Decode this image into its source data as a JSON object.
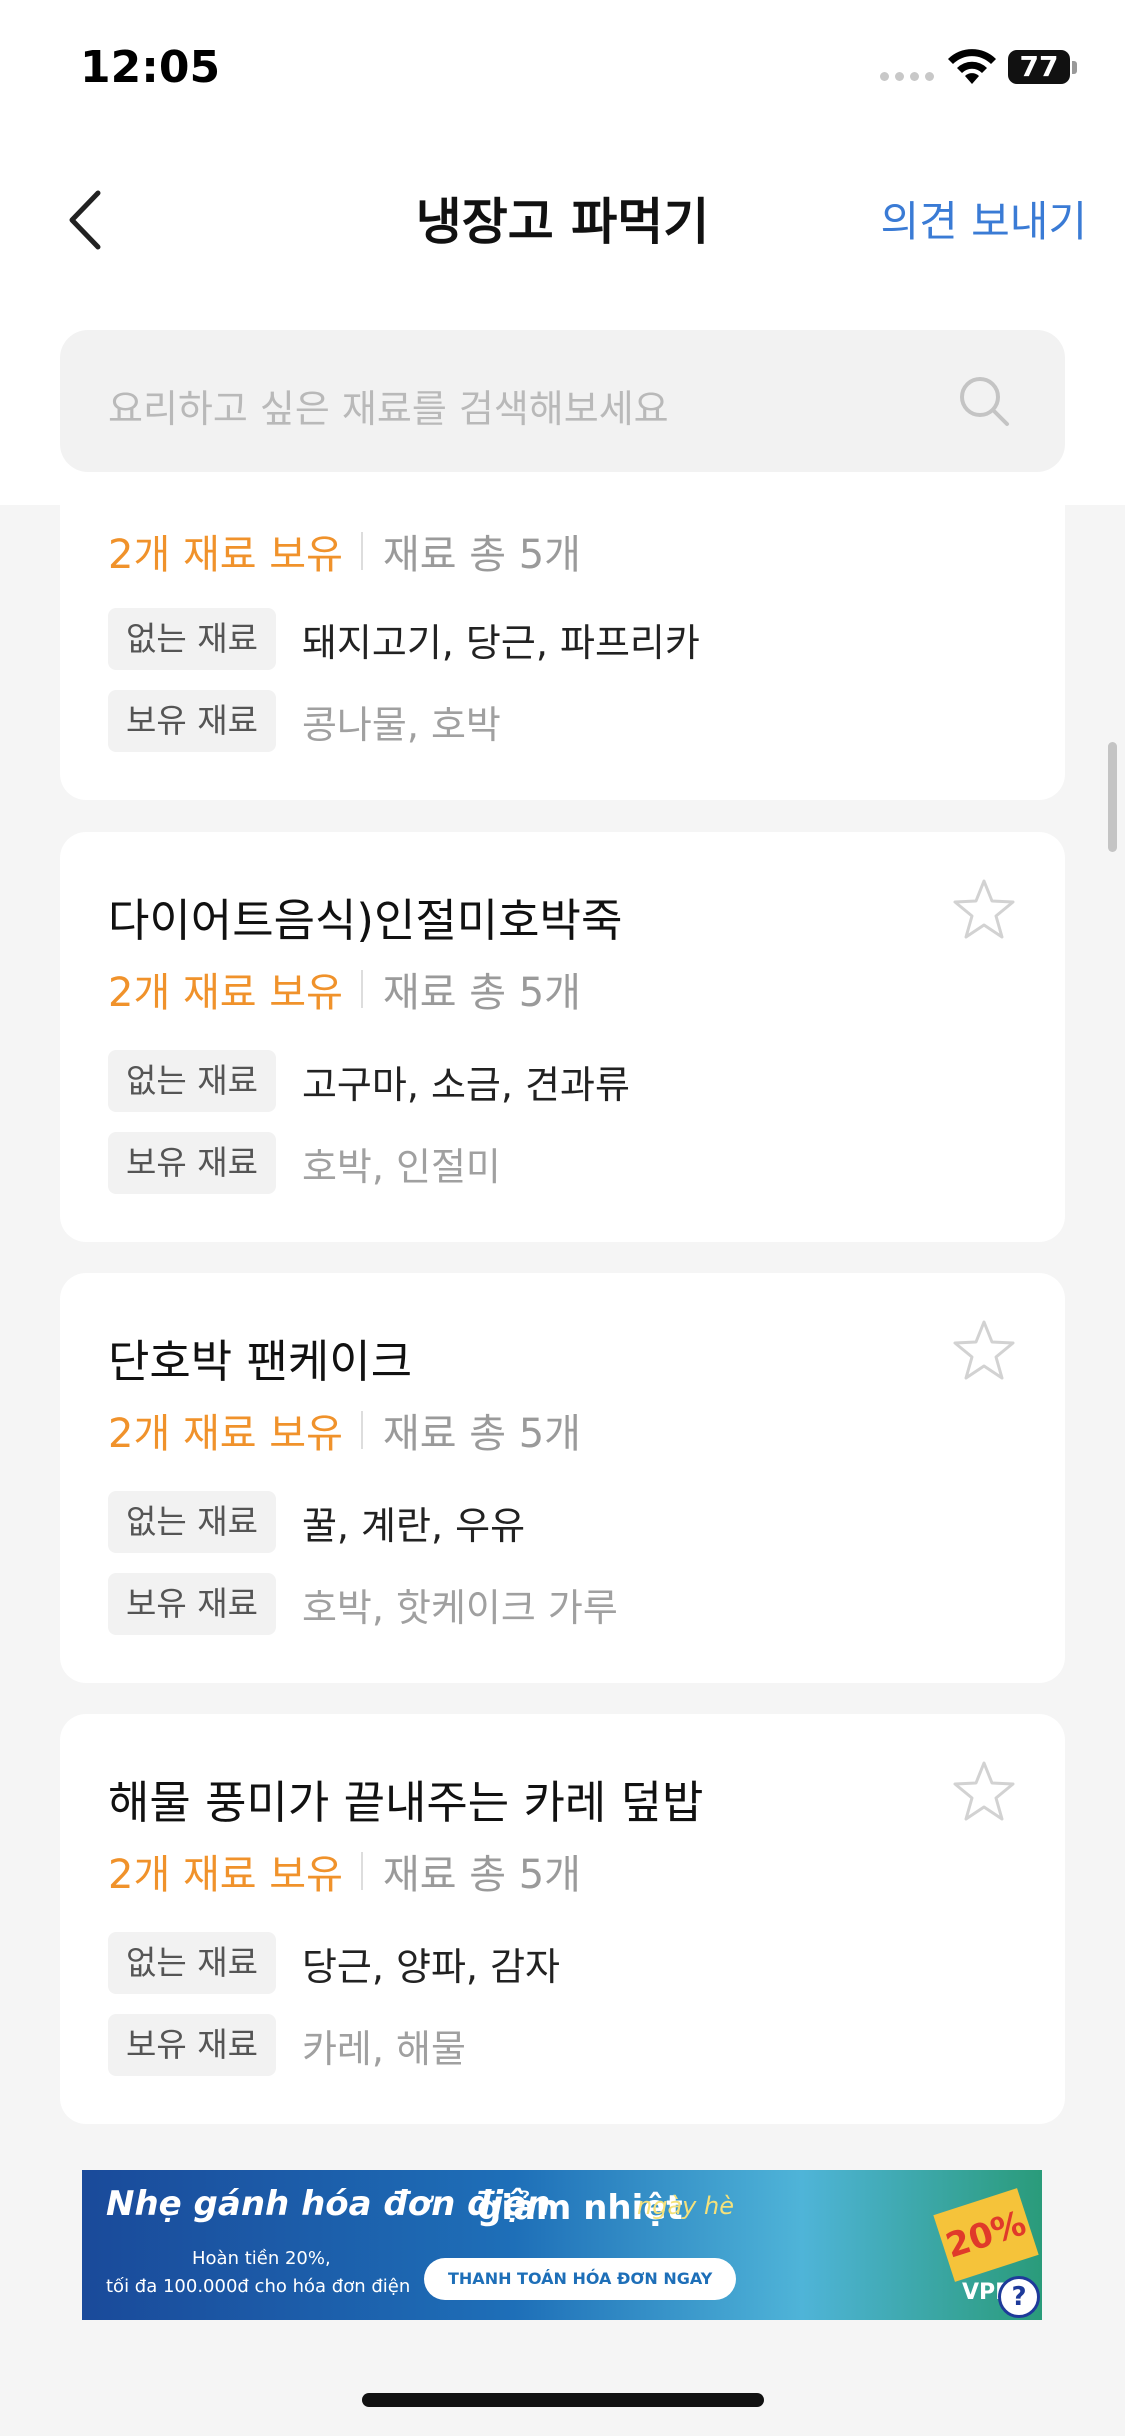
{
  "status_bar": {
    "time": "12:05",
    "battery": "77"
  },
  "header": {
    "title": "냉장고 파먹기",
    "feedback_label": "의견 보내기",
    "back_icon": "chevron-left-icon"
  },
  "search": {
    "placeholder": "요리하고 싶은 재료를 검색해보세요",
    "icon": "search-icon"
  },
  "labels": {
    "missing": "없는 재료",
    "have": "보유 재료",
    "star_icon": "star-outline-icon"
  },
  "recipes": [
    {
      "title": "",
      "owned": "2개 재료 보유",
      "total": "재료 총 5개",
      "missing": "돼지고기, 당근, 파프리카",
      "have": "콩나물, 호박"
    },
    {
      "title": "다이어트음식)인절미호박죽",
      "owned": "2개 재료 보유",
      "total": "재료 총 5개",
      "missing": "고구마, 소금, 견과류",
      "have": "호박, 인절미"
    },
    {
      "title": "단호박 팬케이크",
      "owned": "2개 재료 보유",
      "total": "재료 총 5개",
      "missing": "꿀, 계란, 우유",
      "have": "호박, 핫케이크 가루"
    },
    {
      "title": "해물 풍미가 끝내주는 카레 덮밥",
      "owned": "2개 재료 보유",
      "total": "재료 총 5개",
      "missing": "당근, 양파, 감자",
      "have": "카레, 해물"
    }
  ],
  "ad": {
    "line1": "Nhẹ gánh hóa đơn điện",
    "line2": "giảm nhiệt",
    "line3": "ngày hè",
    "sub1": "Hoàn tiền 20%,",
    "sub2": "tối đa 100.000đ cho hóa đơn điện",
    "button": "THANH TOÁN HÓA ĐƠN NGAY",
    "badge": "20%",
    "brand": "VPBa",
    "help": "?"
  },
  "colors": {
    "accent": "#3a7bd5",
    "owned": "#f0922b"
  }
}
